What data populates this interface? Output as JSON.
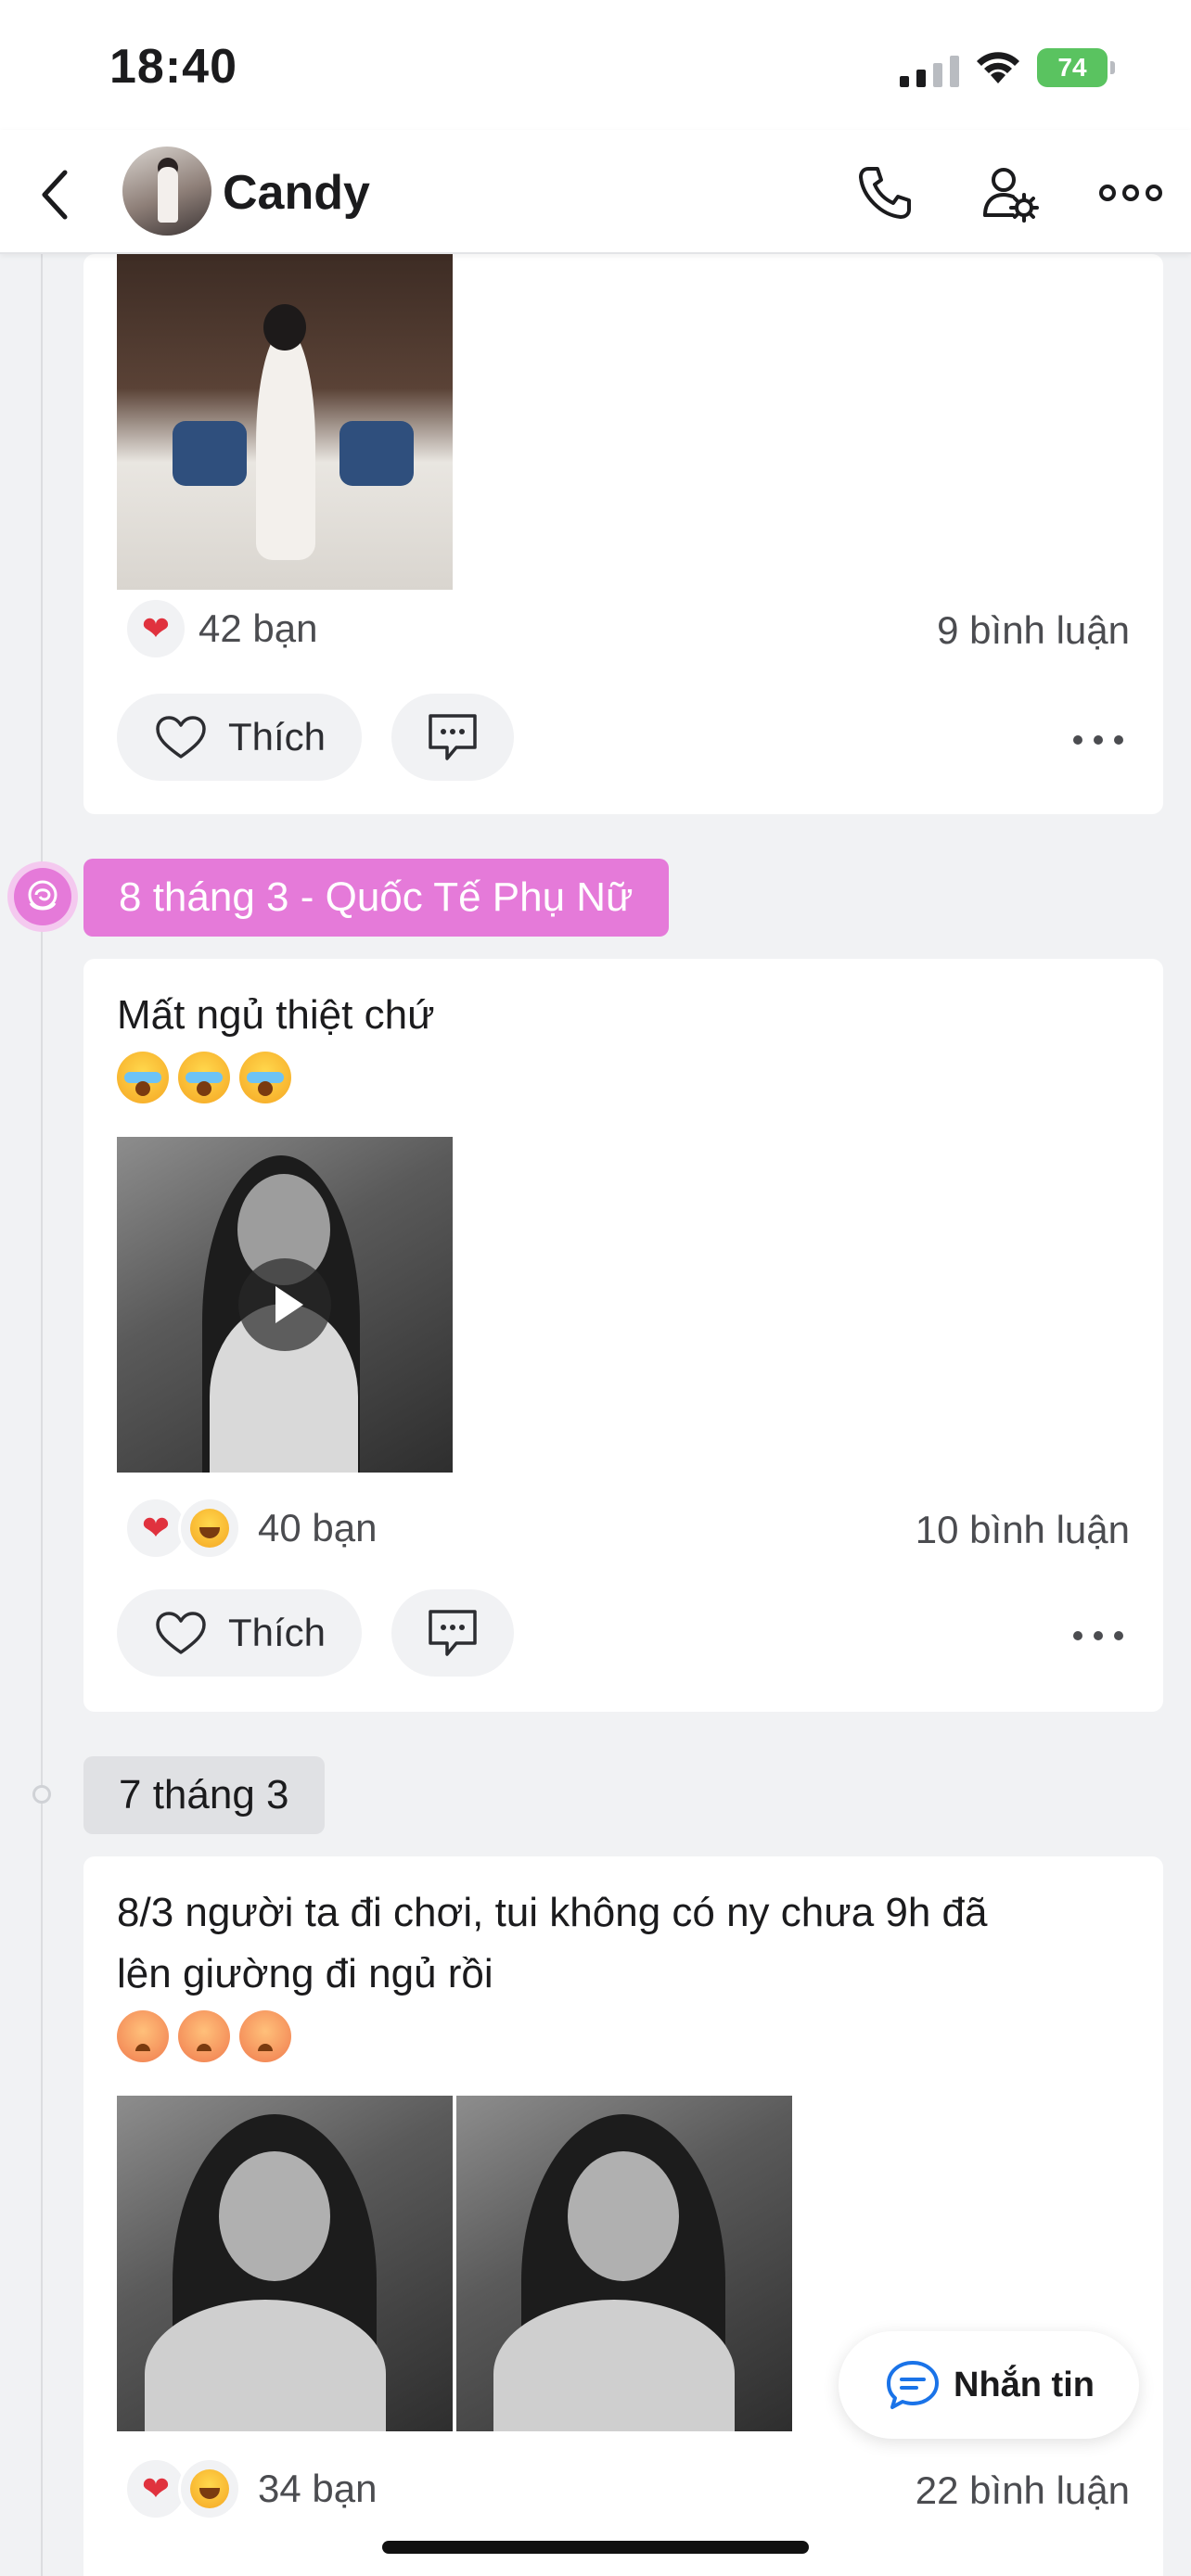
{
  "status_bar": {
    "time": "18:40",
    "battery": "74"
  },
  "header": {
    "contact_name": "Candy"
  },
  "posts": [
    {
      "reaction_count": "42 bạn",
      "comment_count": "9 bình luận",
      "like_label": "Thích"
    },
    {
      "date": "8 tháng 3 - Quốc Tế Phụ Nữ",
      "text": "Mất ngủ thiệt chứ",
      "reaction_count": "40 bạn",
      "comment_count": "10 bình luận",
      "like_label": "Thích"
    },
    {
      "date": "7 tháng 3",
      "text_line1": "8/3 người ta đi chơi, tui không có ny chưa 9h đã",
      "text_line2": "lên giường đi ngủ rồi",
      "reaction_count": "34 bạn",
      "comment_count": "22 bình luận"
    }
  ],
  "fab": {
    "label": "Nhắn tin"
  },
  "colors": {
    "accent_pink": "#e57ad9",
    "heart_red": "#e0323e",
    "battery_green": "#5ac360",
    "link_blue": "#1a73e8"
  },
  "icons": [
    "back-chevron-icon",
    "phone-icon",
    "user-settings-icon",
    "more-icon",
    "heart-outline-icon",
    "comment-icon",
    "chat-bubble-icon",
    "rose-icon",
    "play-icon"
  ]
}
